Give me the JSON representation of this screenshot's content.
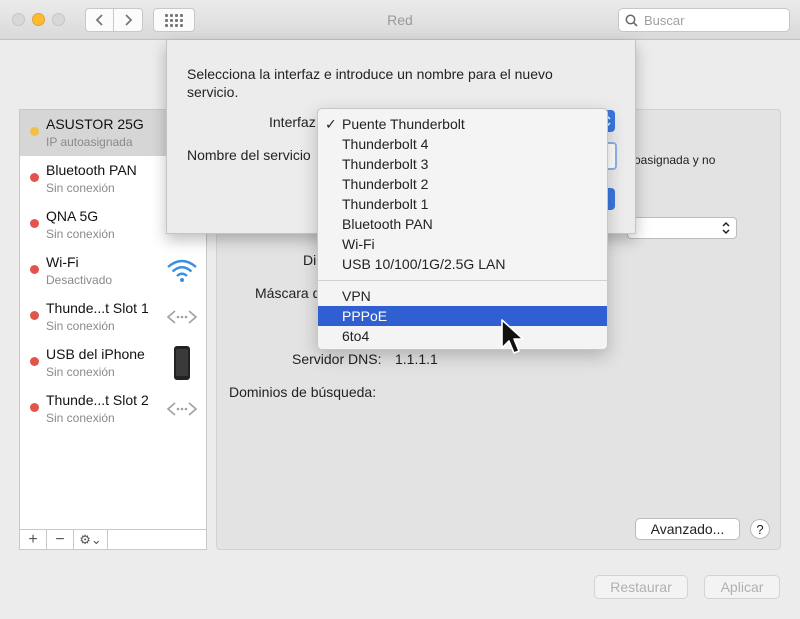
{
  "window": {
    "title": "Red",
    "search_placeholder": "Buscar"
  },
  "sidebar": {
    "services": [
      {
        "name": "ASUSTOR 25G",
        "status": "IP autoasignada",
        "dot_color": "#f2c044",
        "icon": "none",
        "selected": true
      },
      {
        "name": "Bluetooth PAN",
        "status": "Sin conexión",
        "dot_color": "#e2534b",
        "icon": "bluetooth-icon",
        "selected": false
      },
      {
        "name": "QNA 5G",
        "status": "Sin conexión",
        "dot_color": "#e2534b",
        "icon": "ethernet-icon",
        "selected": false
      },
      {
        "name": "Wi-Fi",
        "status": "Desactivado",
        "dot_color": "#e2534b",
        "icon": "wifi-icon",
        "selected": false
      },
      {
        "name": "Thunde...t Slot 1",
        "status": "Sin conexión",
        "dot_color": "#e2534b",
        "icon": "thunderbolt-bridge-icon",
        "selected": false
      },
      {
        "name": "USB del iPhone",
        "status": "Sin conexión",
        "dot_color": "#e2534b",
        "icon": "iphone-icon",
        "selected": false
      },
      {
        "name": "Thunde...t Slot 2",
        "status": "Sin conexión",
        "dot_color": "#e2534b",
        "icon": "thunderbolt-bridge-icon",
        "selected": false
      }
    ],
    "footer": {
      "add": "+",
      "remove": "−",
      "gear": "⚙︎⌄"
    }
  },
  "panel": {
    "status_fragment": "oasignada y no",
    "dir_label_fragment": "Di",
    "mascara_label_fragment": "Máscara d",
    "dns_label": "Servidor DNS:",
    "dns_value": "1.1.1.1",
    "search_domains_label": "Dominios de búsqueda:",
    "advanced_button": "Avanzado...",
    "help_button": "?"
  },
  "footer": {
    "restore_button": "Restaurar",
    "apply_button": "Aplicar"
  },
  "sheet": {
    "instructions": "Selecciona la interfaz e introduce un nombre para el nuevo servicio.",
    "interface_label": "Interfaz",
    "service_name_label": "Nombre del servicio"
  },
  "interface_menu": {
    "checked_item": "Puente Thunderbolt",
    "highlighted_item": "PPPoE",
    "group1": [
      "Puente Thunderbolt",
      "Thunderbolt 4",
      "Thunderbolt 3",
      "Thunderbolt 2",
      "Thunderbolt 1",
      "Bluetooth PAN",
      "Wi-Fi",
      "USB 10/100/1G/2.5G LAN"
    ],
    "group2": [
      "VPN",
      "PPPoE",
      "6to4"
    ],
    "check_glyph": "✓"
  }
}
